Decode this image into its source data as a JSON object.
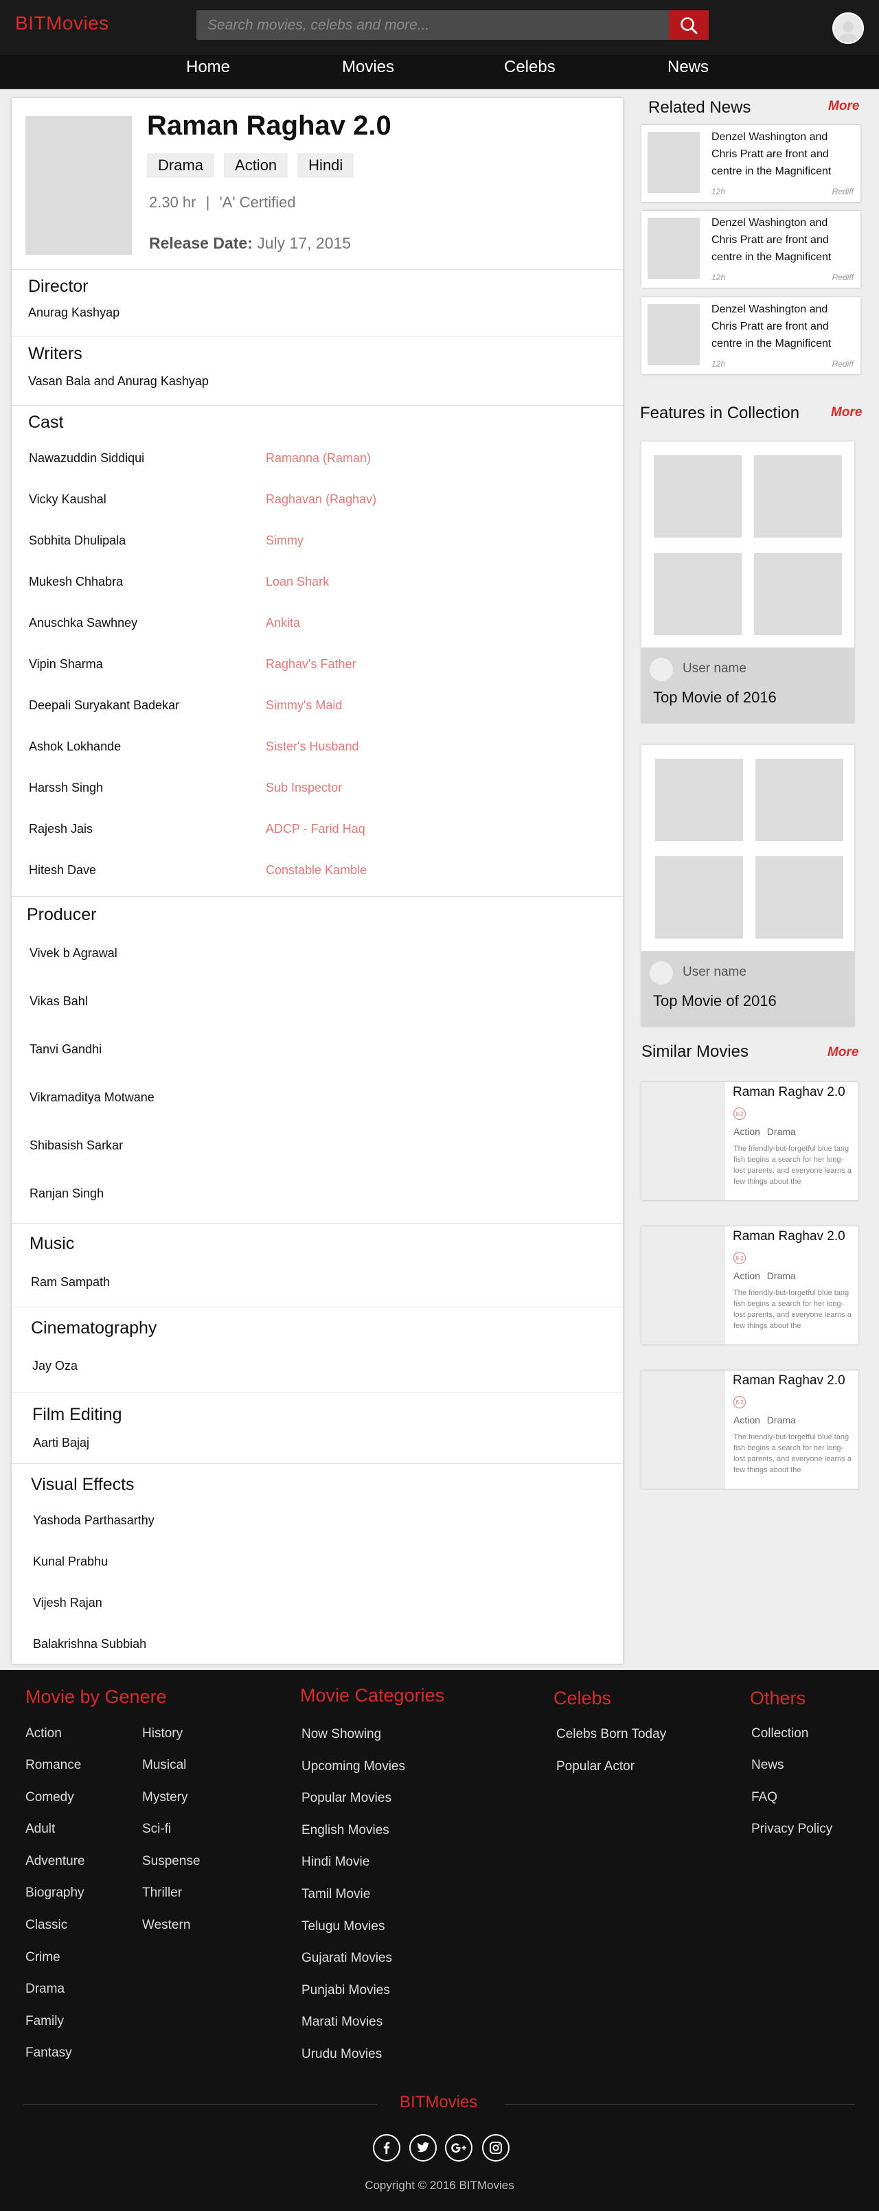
{
  "header": {
    "brand": "BITMovies",
    "search_placeholder": "Search movies, celebs and more..."
  },
  "nav": {
    "items": [
      "Home",
      "Movies",
      "Celebs",
      "News"
    ]
  },
  "movie": {
    "title": "Raman Raghav 2.0",
    "genres": [
      "Drama",
      "Action",
      "Hindi"
    ],
    "duration": "2.30 hr",
    "separator": "|",
    "certificate": "'A' Certified",
    "release_label": "Release Date:",
    "release_date": "July 17, 2015"
  },
  "director": {
    "heading": "Director",
    "name": "Anurag Kashyap"
  },
  "writers": {
    "heading": "Writers",
    "names": "Vasan Bala and Anurag Kashyap"
  },
  "cast": {
    "heading": "Cast",
    "members": [
      {
        "actor": "Nawazuddin Siddiqui",
        "role": "Ramanna (Raman)"
      },
      {
        "actor": "Vicky Kaushal",
        "role": "Raghavan (Raghav)"
      },
      {
        "actor": "Sobhita Dhulipala",
        "role": "Simmy"
      },
      {
        "actor": "Mukesh Chhabra",
        "role": "Loan Shark"
      },
      {
        "actor": "Anuschka Sawhney",
        "role": "Ankita"
      },
      {
        "actor": "Vipin Sharma",
        "role": "Raghav's Father"
      },
      {
        "actor": "Deepali Suryakant Badekar",
        "role": "Simmy's Maid"
      },
      {
        "actor": "Ashok Lokhande",
        "role": "Sister's Husband"
      },
      {
        "actor": "Harssh Singh",
        "role": "Sub Inspector"
      },
      {
        "actor": "Rajesh Jais",
        "role": "ADCP - Farid Haq"
      },
      {
        "actor": "Hitesh Dave",
        "role": "Constable Kamble"
      }
    ]
  },
  "producer": {
    "heading": "Producer",
    "names": [
      "Vivek b Agrawal",
      "Vikas Bahl",
      "Tanvi Gandhi",
      "Vikramaditya Motwane",
      "Shibasish Sarkar",
      "Ranjan Singh"
    ]
  },
  "music": {
    "heading": "Music",
    "name": "Ram Sampath"
  },
  "cinematography": {
    "heading": "Cinematography",
    "name": "Jay Oza"
  },
  "editing": {
    "heading": "Film Editing",
    "name": "Aarti Bajaj"
  },
  "vfx": {
    "heading": "Visual Effects",
    "names": [
      "Yashoda Parthasarthy",
      "Kunal Prabhu",
      "Vijesh Rajan",
      "Balakrishna Subbiah"
    ]
  },
  "sidebar": {
    "more_label": "More",
    "related_news": {
      "heading": "Related News",
      "items": [
        {
          "title": "Denzel Washington and Chris Pratt are front and centre in the Magnificent",
          "time": "12h",
          "source": "Rediff"
        },
        {
          "title": "Denzel Washington and Chris Pratt are front and centre in the Magnificent",
          "time": "12h",
          "source": "Rediff"
        },
        {
          "title": "Denzel Washington and Chris Pratt are front and centre in the Magnificent",
          "time": "12h",
          "source": "Rediff"
        }
      ]
    },
    "collection": {
      "heading": "Features in Collection",
      "items": [
        {
          "user": "User name",
          "title": "Top Movie of 2016"
        },
        {
          "user": "User name",
          "title": "Top Movie of 2016"
        }
      ]
    },
    "similar": {
      "heading": "Similar Movies",
      "items": [
        {
          "title": "Raman Raghav 2.0",
          "rating": "8.2",
          "genres": "Action Drama",
          "desc": "The friendly-but-forgetful blue tang fish begins a search for her long-lost parents, and everyone learns a few things about the"
        },
        {
          "title": "Raman Raghav 2.0",
          "rating": "8.2",
          "genres": "Action Drama",
          "desc": "The friendly-but-forgetful blue tang fish begins a search for her long-lost parents, and everyone learns a few things about the"
        },
        {
          "title": "Raman Raghav 2.0",
          "rating": "8.2",
          "genres": "Action Drama",
          "desc": "The friendly-but-forgetful blue tang fish begins a search for her long-lost parents, and everyone learns a few things about the"
        }
      ]
    }
  },
  "footer": {
    "genre_heading": "Movie by Genere",
    "genres_col1": [
      "Action",
      "Romance",
      "Comedy",
      "Adult",
      "Adventure",
      "Biography",
      "Classic",
      "Crime",
      "Drama",
      "Family",
      "Fantasy"
    ],
    "genres_col2": [
      "History",
      "Musical",
      "Mystery",
      "Sci-fi",
      "Suspense",
      "Thriller",
      "Western"
    ],
    "categories_heading": "Movie Categories",
    "categories": [
      "Now Showing",
      "Upcoming Movies",
      "Popular Movies",
      "English Movies",
      "Hindi Movie",
      "Tamil Movie",
      "Telugu Movies",
      "Gujarati Movies",
      "Punjabi Movies",
      "Marati Movies",
      "Urudu Movies"
    ],
    "celebs_heading": "Celebs",
    "celebs": [
      "Celebs Born Today",
      "Popular Actor"
    ],
    "others_heading": "Others",
    "others": [
      "Collection",
      "News",
      "FAQ",
      "Privacy Policy"
    ],
    "brand": "BITMovies",
    "social": [
      "facebook-icon",
      "twitter-icon",
      "google-plus-icon",
      "instagram-icon"
    ],
    "copyright": "Copyright © 2016 BITMovies"
  },
  "colors": {
    "accent": "#d62c2c",
    "header_bg": "#1a1a1a",
    "footer_bg": "#121212",
    "role_text": "#e27a7a",
    "search_button": "#b5171d"
  }
}
